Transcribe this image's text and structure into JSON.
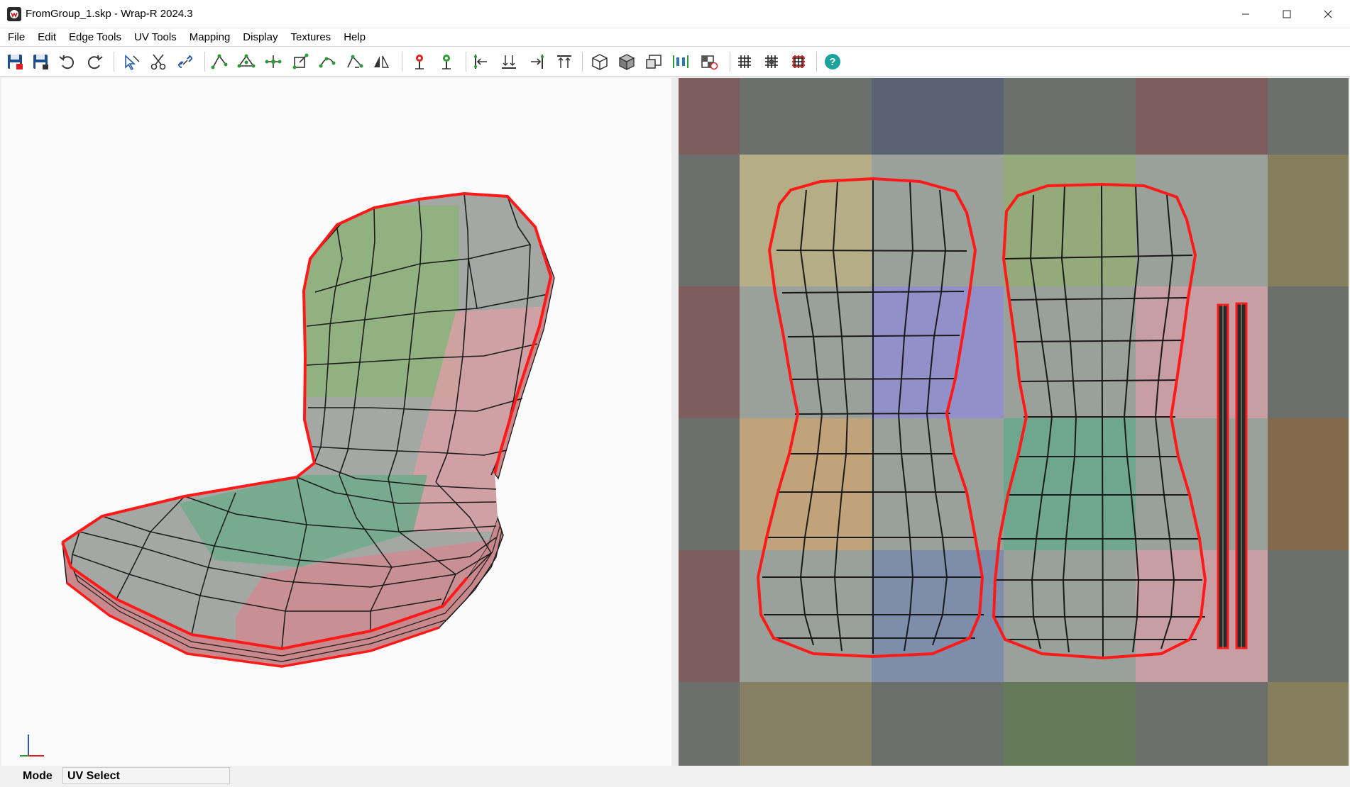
{
  "window": {
    "title": "FromGroup_1.skp - Wrap-R 2024.3",
    "controls": [
      "minimize",
      "maximize",
      "close"
    ]
  },
  "menu": {
    "items": [
      {
        "label": "File"
      },
      {
        "label": "Edit"
      },
      {
        "label": "Edge Tools"
      },
      {
        "label": "UV Tools"
      },
      {
        "label": "Mapping"
      },
      {
        "label": "Display"
      },
      {
        "label": "Textures"
      },
      {
        "label": "Help"
      }
    ]
  },
  "toolbar": {
    "buttons": [
      {
        "icon": "save-red-icon"
      },
      {
        "icon": "save-as-icon"
      },
      {
        "icon": "undo-icon"
      },
      {
        "icon": "redo-icon"
      },
      {
        "icon": "select-cursor-icon"
      },
      {
        "icon": "cut-seam-icon"
      },
      {
        "icon": "unlink-seam-icon"
      },
      {
        "icon": "uv-tool-1-icon"
      },
      {
        "icon": "uv-tool-2-icon"
      },
      {
        "icon": "uv-tool-3-icon"
      },
      {
        "icon": "uv-tool-4-icon"
      },
      {
        "icon": "uv-tool-5-icon"
      },
      {
        "icon": "uv-tool-6-icon"
      },
      {
        "icon": "mirror-icon"
      },
      {
        "icon": "pin-red-icon"
      },
      {
        "icon": "pin-green-icon"
      },
      {
        "icon": "align-left-icon"
      },
      {
        "icon": "align-bottom-icon"
      },
      {
        "icon": "align-right-icon"
      },
      {
        "icon": "align-top-icon"
      },
      {
        "icon": "box-map-icon"
      },
      {
        "icon": "solid-box-icon"
      },
      {
        "icon": "frame-icon"
      },
      {
        "icon": "distribute-icon"
      },
      {
        "icon": "checker-icon"
      },
      {
        "icon": "grid-icon"
      },
      {
        "icon": "grid-snap-icon"
      },
      {
        "icon": "grid-red-icon"
      },
      {
        "icon": "help-icon"
      }
    ]
  },
  "colors": {
    "seam": "#ff1a1a",
    "wire": "#1a1a1a",
    "help": "#1aa39a"
  },
  "status": {
    "mode_label": "Mode",
    "mode_value": "UV Select"
  }
}
